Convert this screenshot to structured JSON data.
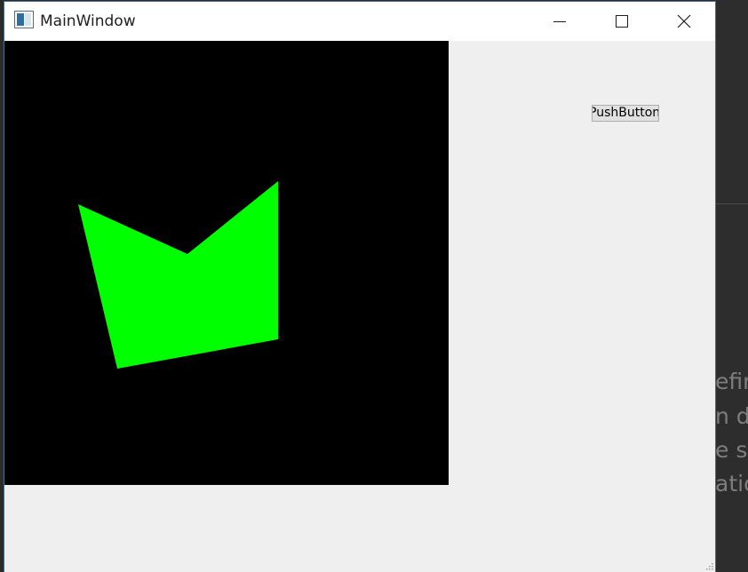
{
  "window": {
    "title": "MainWindow",
    "controls": {
      "minimize_icon": "minimize-icon",
      "maximize_icon": "maximize-icon",
      "close_icon": "close-icon"
    }
  },
  "canvas": {
    "background": "#000000",
    "shape_color": "#00ff00",
    "shape": "green polygon"
  },
  "push_button": {
    "label": "PushButton"
  },
  "background_text": [
    "efin",
    "n de",
    "e sy",
    "atio"
  ],
  "colors": {
    "window_bg": "#efefef",
    "titlebar_bg": "#ffffff",
    "desktop_bg": "#2d2d2d"
  }
}
